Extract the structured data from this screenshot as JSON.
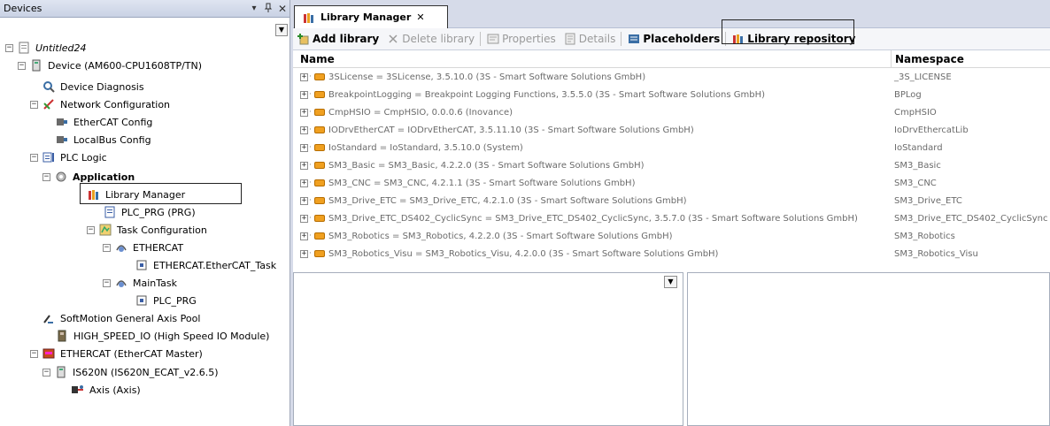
{
  "devices_pane": {
    "title": "Devices",
    "pin_glyph": "▾",
    "dock_glyph": "ᵖ",
    "close_glyph": "✕",
    "dropdown_glyph": "▼"
  },
  "tree": [
    {
      "label": "Untitled24",
      "italic": true,
      "icon": "project-icon"
    },
    {
      "label": "Device (AM600-CPU1608TP/TN)",
      "icon": "device-icon"
    },
    {
      "label": "Device Diagnosis",
      "icon": "diagnosis-icon"
    },
    {
      "label": "Network Configuration",
      "icon": "network-icon"
    },
    {
      "label": "EtherCAT Config",
      "icon": "ethercat-config-icon"
    },
    {
      "label": "LocalBus Config",
      "icon": "localbus-config-icon"
    },
    {
      "label": "PLC Logic",
      "icon": "plc-logic-icon"
    },
    {
      "label": "Application",
      "bold": true,
      "icon": "application-icon"
    },
    {
      "label": "Library Manager",
      "icon": "library-manager-icon"
    },
    {
      "label": "PLC_PRG (PRG)",
      "icon": "program-icon"
    },
    {
      "label": "Task Configuration",
      "icon": "task-config-icon"
    },
    {
      "label": "ETHERCAT",
      "icon": "task-icon"
    },
    {
      "label": "ETHERCAT.EtherCAT_Task",
      "icon": "task-call-icon"
    },
    {
      "label": "MainTask",
      "icon": "task-icon"
    },
    {
      "label": "PLC_PRG",
      "icon": "task-call-icon"
    },
    {
      "label": "SoftMotion General Axis Pool",
      "icon": "axis-pool-icon"
    },
    {
      "label": "HIGH_SPEED_IO (High Speed IO Module)",
      "icon": "io-module-icon"
    },
    {
      "label": "ETHERCAT (EtherCAT Master)",
      "icon": "ethercat-master-icon"
    },
    {
      "label": "IS620N (IS620N_ECAT_v2.6.5)",
      "icon": "slave-device-icon"
    },
    {
      "label": "Axis (Axis)",
      "icon": "axis-icon"
    }
  ],
  "editor": {
    "tab_label": "Library Manager",
    "tab_close": "✕",
    "toolbar": {
      "add_library": "Add library",
      "delete_library": "Delete library",
      "properties": "Properties",
      "details": "Details",
      "placeholders": "Placeholders",
      "library_repository": "Library repository"
    },
    "columns": {
      "name": "Name",
      "namespace": "Namespace"
    },
    "libraries": [
      {
        "name": "3SLicense = 3SLicense, 3.5.10.0 (3S - Smart Software Solutions GmbH)",
        "namespace": "_3S_LICENSE"
      },
      {
        "name": "BreakpointLogging = Breakpoint Logging Functions, 3.5.5.0 (3S - Smart Software Solutions GmbH)",
        "namespace": "BPLog"
      },
      {
        "name": "CmpHSIO = CmpHSIO, 0.0.0.6 (Inovance)",
        "namespace": "CmpHSIO"
      },
      {
        "name": "IODrvEtherCAT = IODrvEtherCAT, 3.5.11.10 (3S - Smart Software Solutions GmbH)",
        "namespace": "IoDrvEthercatLib"
      },
      {
        "name": "IoStandard = IoStandard, 3.5.10.0 (System)",
        "namespace": "IoStandard"
      },
      {
        "name": "SM3_Basic = SM3_Basic, 4.2.2.0 (3S - Smart Software Solutions GmbH)",
        "namespace": "SM3_Basic"
      },
      {
        "name": "SM3_CNC = SM3_CNC, 4.2.1.1 (3S - Smart Software Solutions GmbH)",
        "namespace": "SM3_CNC"
      },
      {
        "name": "SM3_Drive_ETC = SM3_Drive_ETC, 4.2.1.0 (3S - Smart Software Solutions GmbH)",
        "namespace": "SM3_Drive_ETC"
      },
      {
        "name": "SM3_Drive_ETC_DS402_CyclicSync = SM3_Drive_ETC_DS402_CyclicSync, 3.5.7.0 (3S - Smart Software Solutions GmbH)",
        "namespace": "SM3_Drive_ETC_DS402_CyclicSync"
      },
      {
        "name": "SM3_Robotics = SM3_Robotics, 4.2.2.0 (3S - Smart Software Solutions GmbH)",
        "namespace": "SM3_Robotics"
      },
      {
        "name": "SM3_Robotics_Visu = SM3_Robotics_Visu, 4.2.0.0 (3S - Smart Software Solutions GmbH)",
        "namespace": "SM3_Robotics_Visu"
      }
    ],
    "bottom_dropdown_glyph": "▼"
  }
}
